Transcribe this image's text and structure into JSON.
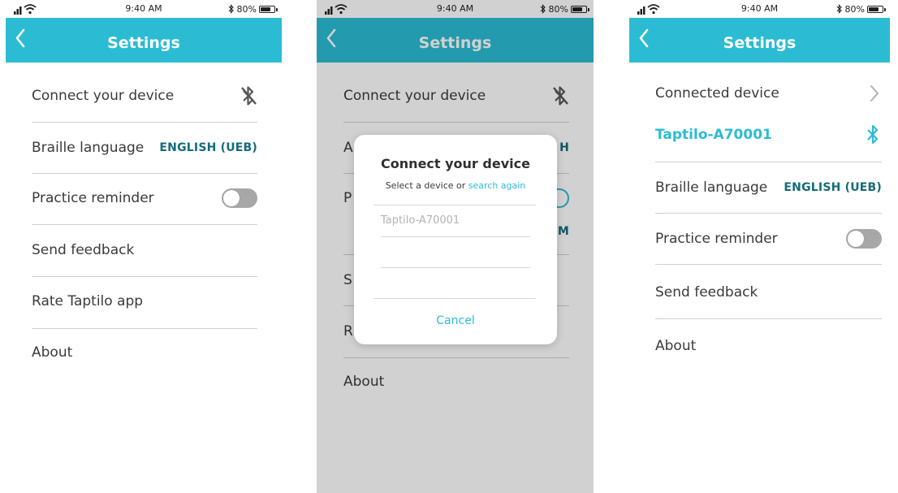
{
  "colors": {
    "accent": "#2bbcd3",
    "accent_dark": "#2aa2b0",
    "value_text": "#136b79"
  },
  "status": {
    "time": "9:40 AM",
    "battery": "80%",
    "battery_level": 0.8
  },
  "screen1": {
    "title": "Settings",
    "rows": [
      {
        "label": "Connect your device",
        "icon": "bluetooth-disabled-icon"
      },
      {
        "label": "Braille language",
        "value": "ENGLISH (UEB)"
      },
      {
        "label": "Practice reminder",
        "toggle": false
      },
      {
        "label": "Send feedback"
      },
      {
        "label": "Rate Taptilo app"
      },
      {
        "label": "About"
      }
    ]
  },
  "screen2": {
    "title": "Settings",
    "rows": [
      {
        "label": "Connect your device",
        "icon": "bluetooth-disabled-icon"
      },
      {
        "label": "A",
        "value": "H"
      },
      {
        "label": "P",
        "value": "M"
      },
      {
        "label": "S"
      },
      {
        "label": "R"
      },
      {
        "label": "About"
      }
    ],
    "modal": {
      "title": "Connect your device",
      "subtitle": "Select a device or ",
      "link": "search again",
      "devices": [
        "Taptilo-A70001"
      ],
      "cancel": "Cancel"
    }
  },
  "screen3": {
    "title": "Settings",
    "rows": [
      {
        "label": "Connected device",
        "icon": "chevron-right-icon"
      },
      {
        "label": "Taptilo-A70001",
        "icon": "bluetooth-icon"
      },
      {
        "label": "Braille language",
        "value": "ENGLISH (UEB)"
      },
      {
        "label": "Practice reminder",
        "toggle": false
      },
      {
        "label": "Send feedback"
      },
      {
        "label": "About"
      }
    ]
  }
}
